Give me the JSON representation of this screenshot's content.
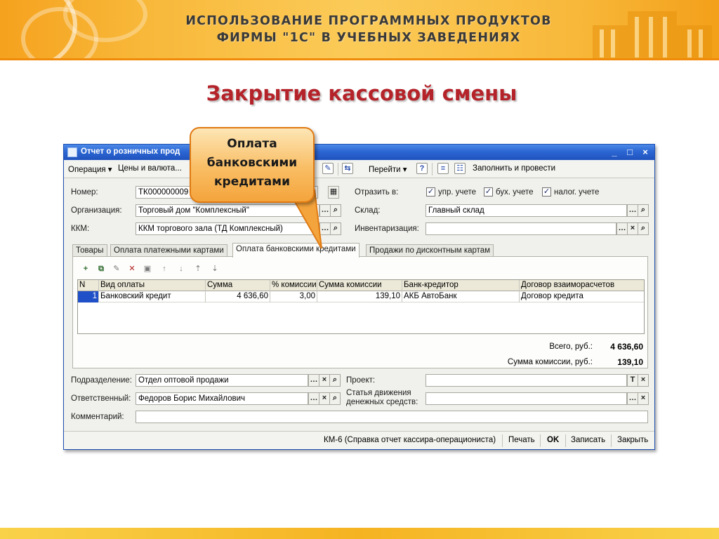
{
  "banner": {
    "line1": "Использование программных продуктов",
    "line2": "фирмы \"1С\" в учебных заведениях"
  },
  "slide_title": "Закрытие кассовой смены",
  "callout": {
    "line1": "Оплата",
    "line2": "банковскими",
    "line3": "кредитами"
  },
  "window": {
    "title": "Отчет о розничных прод",
    "title_tail": "…",
    "controls": {
      "minimize": "_",
      "maximize": "□",
      "close": "×"
    }
  },
  "toolbar": {
    "operation": "Операция ▾",
    "prices": "Цены и валюта...",
    "goto": "Перейти ▾",
    "help": "?",
    "fill_and_post": "Заполнить и провести"
  },
  "form": {
    "number_label": "Номер:",
    "number_value": "ТК000000009",
    "org_label": "Организация:",
    "org_value": "Торговый дом \"Комплексный\"",
    "kkm_label": "ККМ:",
    "kkm_value": "ККМ торгового зала (ТД Комплексный)",
    "reflect_label": "Отразить в:",
    "reflect_options": [
      "упр. учете",
      "бух. учете",
      "налог. учете"
    ],
    "warehouse_label": "Склад:",
    "warehouse_value": "Главный склад",
    "inventory_label": "Инвентаризация:",
    "inventory_value": ""
  },
  "tabs": [
    {
      "label": "Товары",
      "active": false
    },
    {
      "label": "Оплата платежными картами",
      "active": false
    },
    {
      "label": "Оплата банковскими кредитами",
      "active": true
    },
    {
      "label": "Продажи по дисконтным картам",
      "active": false
    }
  ],
  "grid": {
    "columns": [
      "N",
      "Вид оплаты",
      "Сумма",
      "% комиссии",
      "Сумма комиссии",
      "Банк-кредитор",
      "Договор взаиморасчетов"
    ],
    "rows": [
      [
        "1",
        "Банковский кредит",
        "4 636,60",
        "3,00",
        "139,10",
        "АКБ АвтоБанк",
        "Договор кредита"
      ]
    ]
  },
  "totals": {
    "total_label": "Всего, руб.:",
    "total_value": "4 636,60",
    "commission_label": "Сумма комиссии, руб.:",
    "commission_value": "139,10"
  },
  "bottom_form": {
    "division_label": "Подразделение:",
    "division_value": "Отдел оптовой продажи",
    "responsible_label": "Ответственный:",
    "responsible_value": "Федоров Борис Михайлович",
    "comment_label": "Комментарий:",
    "comment_value": "",
    "project_label": "Проект:",
    "project_value": "",
    "cashflow_label_1": "Статья движения",
    "cashflow_label_2": "денежных средств:",
    "cashflow_value": ""
  },
  "statusbar": {
    "km6": "КМ-6 (Справка отчет кассира-операциониста)",
    "print": "Печать",
    "ok": "OK",
    "save": "Записать",
    "close": "Закрыть"
  },
  "colors": {
    "accent_title": "#b5232a",
    "banner": "#f8b83a",
    "window_titlebar": "#2c66d3",
    "callout": "#f9bd63"
  }
}
